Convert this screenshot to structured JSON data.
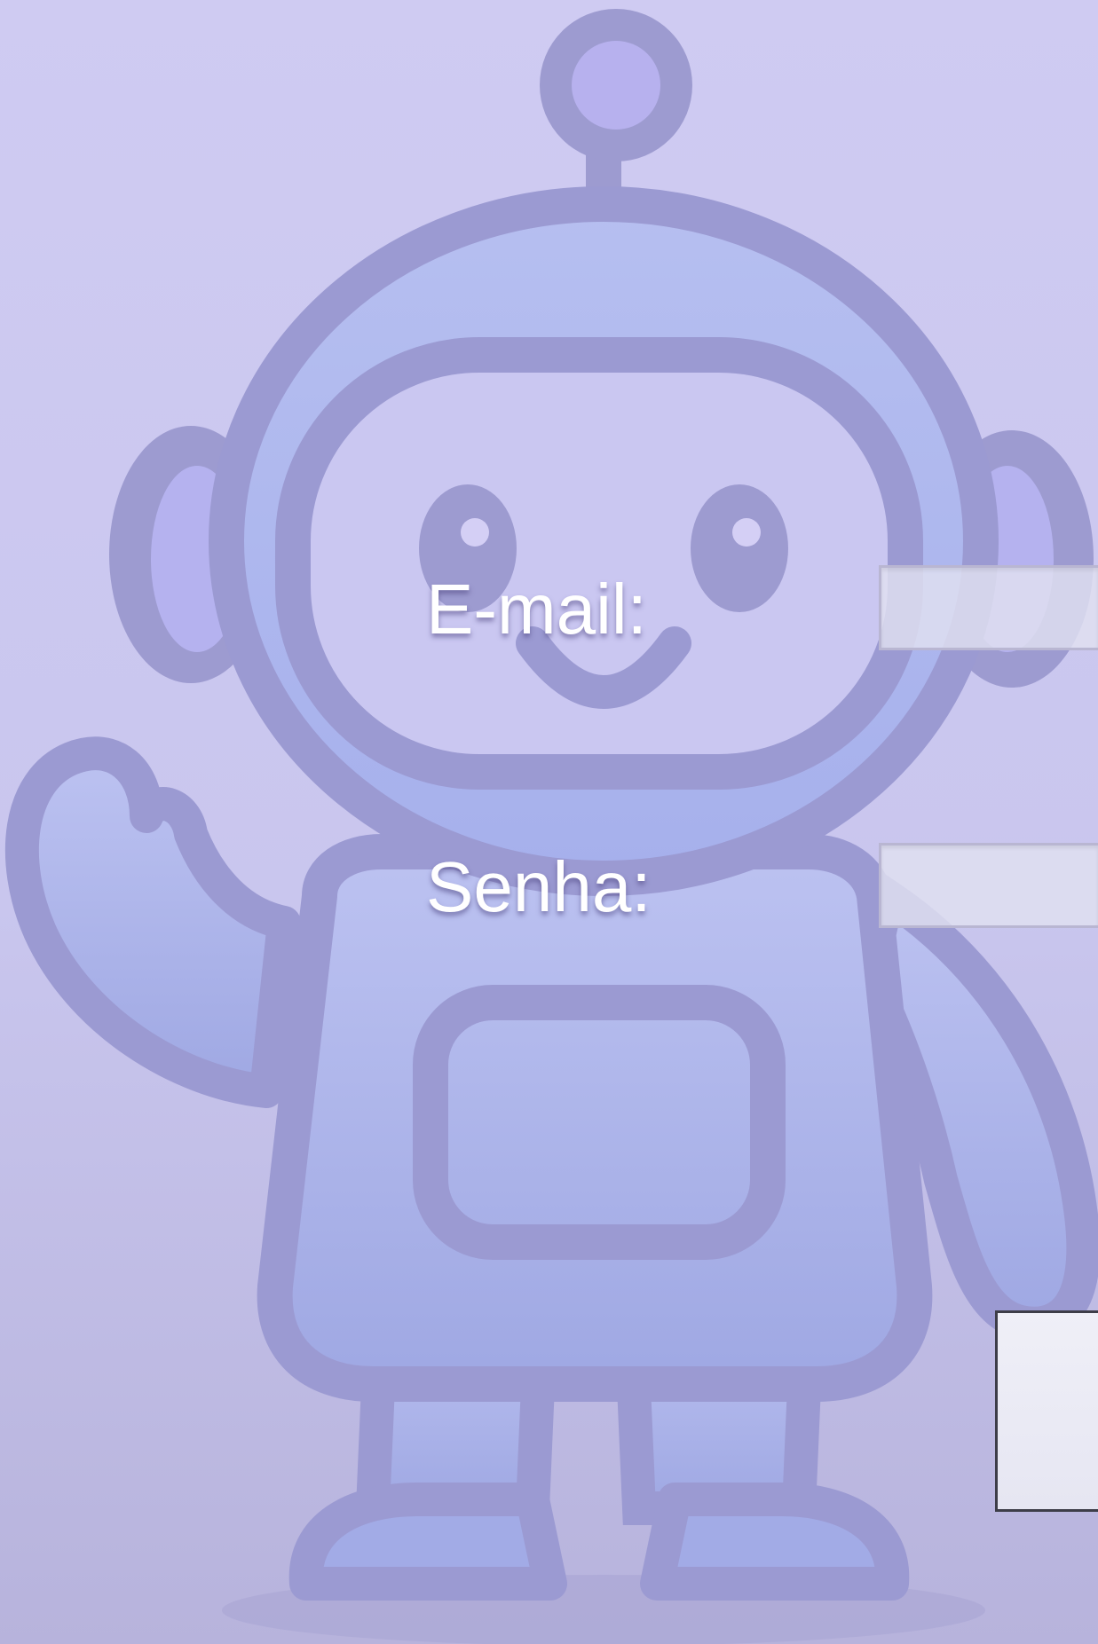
{
  "form": {
    "email_label": "E-mail:",
    "email_value": "",
    "password_label": "Senha:",
    "password_value": "",
    "submit_label": ""
  },
  "colors": {
    "background": "#cdc9f1",
    "robot_outline": "#9b9ad2",
    "robot_fill": "#b0b8ee",
    "label_text": "#ffffff"
  }
}
